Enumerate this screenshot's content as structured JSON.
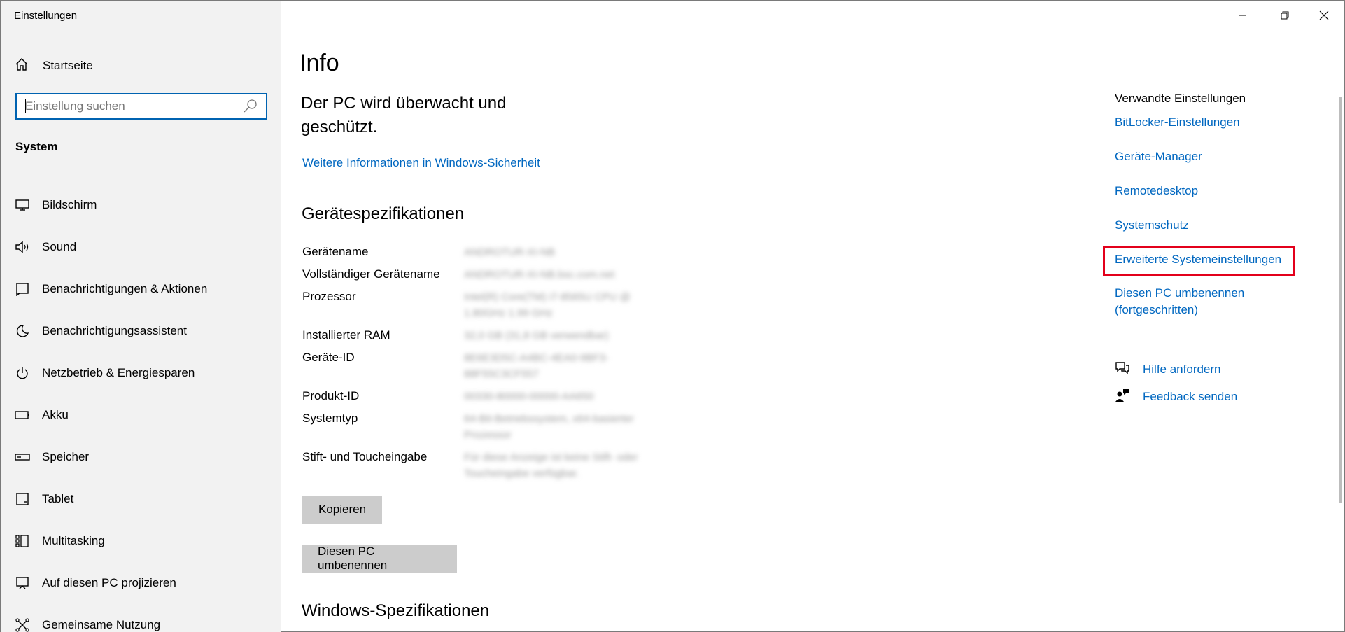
{
  "window": {
    "title": "Einstellungen",
    "controls": [
      "minimize",
      "restore",
      "close"
    ]
  },
  "sidebar": {
    "home_label": "Startseite",
    "search": {
      "placeholder": "Einstellung suchen"
    },
    "section": "System",
    "items": [
      {
        "label": "Bildschirm",
        "icon": "monitor-icon"
      },
      {
        "label": "Sound",
        "icon": "speaker-icon"
      },
      {
        "label": "Benachrichtigungen & Aktionen",
        "icon": "notification-icon"
      },
      {
        "label": "Benachrichtigungsassistent",
        "icon": "moon-icon"
      },
      {
        "label": "Netzbetrieb & Energiesparen",
        "icon": "power-icon"
      },
      {
        "label": "Akku",
        "icon": "battery-icon"
      },
      {
        "label": "Speicher",
        "icon": "storage-icon"
      },
      {
        "label": "Tablet",
        "icon": "tablet-icon"
      },
      {
        "label": "Multitasking",
        "icon": "multitasking-icon"
      },
      {
        "label": "Auf diesen PC projizieren",
        "icon": "project-icon"
      },
      {
        "label": "Gemeinsame Nutzung",
        "icon": "share-icon"
      }
    ]
  },
  "main": {
    "title": "Info",
    "protection_text": "Der PC wird überwacht und geschützt.",
    "security_link": "Weitere Informationen in Windows-Sicherheit",
    "device_specs": {
      "heading": "Gerätespezifikationen",
      "rows": [
        {
          "label": "Gerätename",
          "value": "ANDROTUR-XI-NB"
        },
        {
          "label": "Vollständiger Gerätename",
          "value": "ANDROTUR-XI-NB.bsc.com.net"
        },
        {
          "label": "Prozessor",
          "value": "Intel(R) Core(TM) i7-8565U CPU @ 1.80GHz 1.99 GHz"
        },
        {
          "label": "Installierter RAM",
          "value": "32,0 GB (31,8 GB verwendbar)"
        },
        {
          "label": "Geräte-ID",
          "value": "8E6E3D5C-A4BC-4EA0-9BF3-88F55C3CF557"
        },
        {
          "label": "Produkt-ID",
          "value": "00330-80000-00000-AA650"
        },
        {
          "label": "Systemtyp",
          "value": "64-Bit-Betriebssystem, x64-basierter Prozessor"
        },
        {
          "label": "Stift- und Toucheingabe",
          "value": "Für diese Anzeige ist keine Stift- oder Toucheingabe verfügbar."
        }
      ],
      "copy_button": "Kopieren",
      "rename_button": "Diesen PC umbenennen"
    },
    "windows_specs_heading": "Windows-Spezifikationen"
  },
  "related": {
    "title": "Verwandte Einstellungen",
    "links": [
      "BitLocker-Einstellungen",
      "Geräte-Manager",
      "Remotedesktop",
      "Systemschutz",
      "Erweiterte Systemeinstellungen",
      "Diesen PC umbenennen (fortgeschritten)"
    ],
    "help": "Hilfe anfordern",
    "feedback": "Feedback senden"
  },
  "colors": {
    "accent": "#0067c0",
    "sidebar_bg": "#f2f2f2",
    "highlight": "#e3001b",
    "button_bg": "#cccccc"
  }
}
